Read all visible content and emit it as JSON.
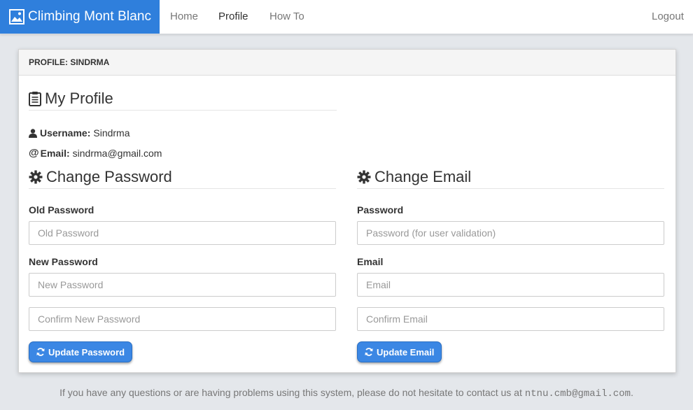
{
  "nav": {
    "brand": "Climbing Mont Blanc",
    "brand_icon": "image-icon",
    "links": [
      "Home",
      "Profile",
      "How To"
    ],
    "logout": "Logout",
    "brand_color": "#2f7fdc"
  },
  "panel": {
    "heading": "PROFILE: SINDRMA",
    "title": "My Profile",
    "username_label": "Username:",
    "username_value": "Sindrma",
    "email_label": "Email:",
    "email_value": "sindrma@gmail.com"
  },
  "change_password": {
    "title": "Change Password",
    "old_label": "Old Password",
    "old_placeholder": "Old Password",
    "new_label": "New Password",
    "new_placeholder": "New Password",
    "confirm_placeholder": "Confirm New Password",
    "button": "Update Password"
  },
  "change_email": {
    "title": "Change Email",
    "password_label": "Password",
    "password_placeholder": "Password (for user validation)",
    "email_label": "Email",
    "email_placeholder": "Email",
    "confirm_placeholder": "Confirm Email",
    "button": "Update Email"
  },
  "footer": {
    "text": "If you have any questions or are having problems using this system, please do not hesitate to contact us at",
    "email": "ntnu.cmb@gmail.com",
    "end": "."
  },
  "colors": {
    "button": "#3b87e4",
    "background": "#e4e7eb"
  }
}
